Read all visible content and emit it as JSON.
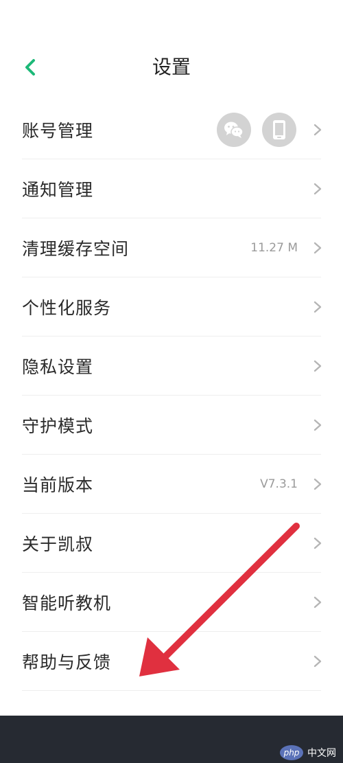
{
  "header": {
    "title": "设置",
    "back_icon": "chevron-left-icon",
    "accent_color": "#1db978"
  },
  "settings": {
    "account": {
      "label": "账号管理",
      "bound_icons": [
        "wechat-icon",
        "phone-icon"
      ]
    },
    "notification": {
      "label": "通知管理"
    },
    "cache": {
      "label": "清理缓存空间",
      "value": "11.27 M"
    },
    "personalized": {
      "label": "个性化服务"
    },
    "privacy": {
      "label": "隐私设置"
    },
    "guard_mode": {
      "label": "守护模式"
    },
    "version": {
      "label": "当前版本",
      "value": "V7.3.1"
    },
    "about": {
      "label": "关于凯叔"
    },
    "smart_device": {
      "label": "智能听教机"
    },
    "help": {
      "label": "帮助与反馈"
    }
  },
  "annotation": {
    "arrow_color": "#e0303f",
    "target": "帮助与反馈"
  },
  "watermark": {
    "badge": "php",
    "text": "中文网"
  },
  "colors": {
    "chevron": "#b5b5b5",
    "icon_bg": "#d3d3d3",
    "bottom_bar": "#262a32"
  }
}
